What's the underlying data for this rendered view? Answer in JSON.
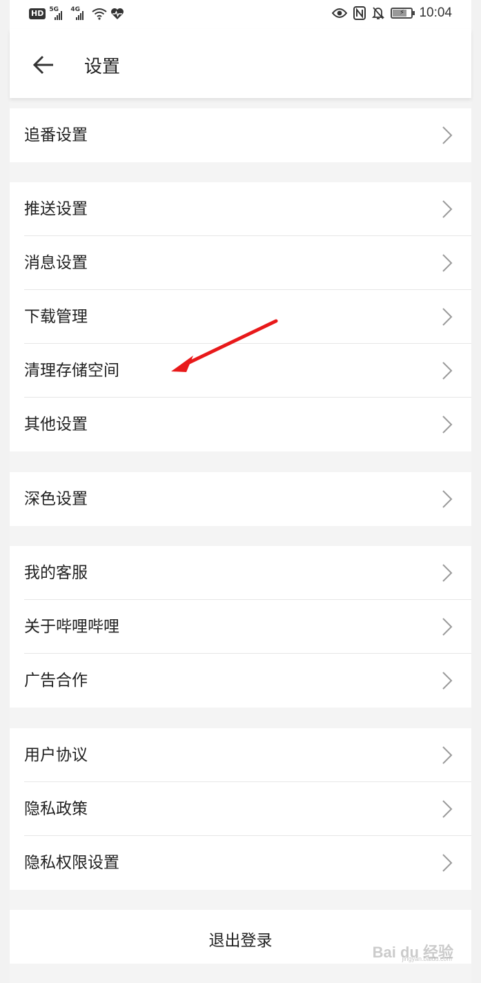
{
  "status_bar": {
    "hd_badge": "HD",
    "network_1": "5G",
    "network_2": "4G",
    "time": "10:04",
    "icons": [
      "hd-icon",
      "signal-5g-icon",
      "signal-4g-icon",
      "wifi-icon",
      "heart-rate-icon",
      "eye-icon",
      "nfc-icon",
      "mute-icon",
      "battery-charging-icon"
    ]
  },
  "header": {
    "title": "设置",
    "back_icon": "arrow-left-icon"
  },
  "groups": [
    {
      "items": [
        {
          "label": "追番设置"
        }
      ]
    },
    {
      "items": [
        {
          "label": "推送设置"
        },
        {
          "label": "消息设置"
        },
        {
          "label": "下载管理"
        },
        {
          "label": "清理存储空间"
        },
        {
          "label": "其他设置"
        }
      ]
    },
    {
      "items": [
        {
          "label": "深色设置"
        }
      ]
    },
    {
      "items": [
        {
          "label": "我的客服"
        },
        {
          "label": "关于哔哩哔哩"
        },
        {
          "label": "广告合作"
        }
      ]
    },
    {
      "items": [
        {
          "label": "用户协议"
        },
        {
          "label": "隐私政策"
        },
        {
          "label": "隐私权限设置"
        }
      ]
    }
  ],
  "logout": {
    "label": "退出登录"
  },
  "annotation": {
    "color": "#e8191a",
    "target": "清理存储空间"
  },
  "watermark": {
    "text": "Bai du 经验",
    "sub": "jingyan.baidu.com"
  },
  "colors": {
    "background": "#f4f4f4",
    "card": "#ffffff",
    "text": "#212121",
    "chevron": "#9a9a9a",
    "divider": "#e6e6e6"
  }
}
